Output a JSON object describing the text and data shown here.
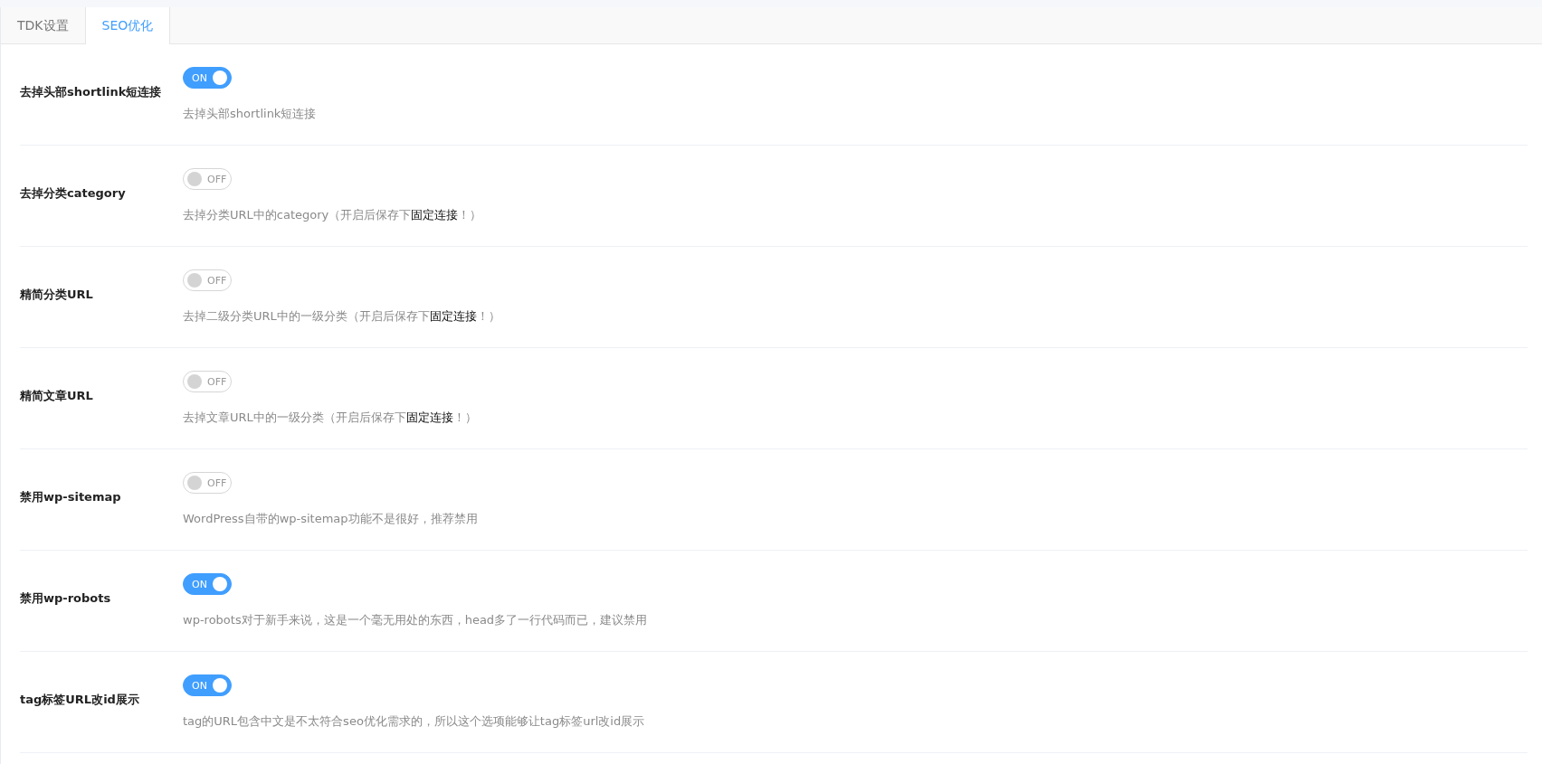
{
  "tabs": [
    {
      "label": "TDK设置",
      "selected": false
    },
    {
      "label": "SEO优化",
      "selected": true
    }
  ],
  "settings": [
    {
      "label": "去掉头部shortlink短连接",
      "on": true,
      "toggle_text": "ON",
      "description": "去掉头部shortlink短连接"
    },
    {
      "label": "去掉分类category",
      "on": false,
      "toggle_text": "OFF",
      "description": "去掉分类URL中的category（开启后保存下**固定连接**！）"
    },
    {
      "label": "精简分类URL",
      "on": false,
      "toggle_text": "OFF",
      "description": "去掉二级分类URL中的一级分类（开启后保存下**固定连接**！）"
    },
    {
      "label": "精简文章URL",
      "on": false,
      "toggle_text": "OFF",
      "description": "去掉文章URL中的一级分类（开启后保存下**固定连接**！）"
    },
    {
      "label": "禁用wp-sitemap",
      "on": false,
      "toggle_text": "OFF",
      "description": "WordPress自带的wp-sitemap功能不是很好，推荐禁用"
    },
    {
      "label": "禁用wp-robots",
      "on": true,
      "toggle_text": "ON",
      "description": "wp-robots对于新手来说，这是一个毫无用处的东西，head多了一行代码而已，建议禁用"
    },
    {
      "label": "tag标签URL改id展示",
      "on": true,
      "toggle_text": "ON",
      "description": "tag的URL包含中文是不太符合seo优化需求的，所以这个选项能够让tag标签url改id展示"
    }
  ]
}
